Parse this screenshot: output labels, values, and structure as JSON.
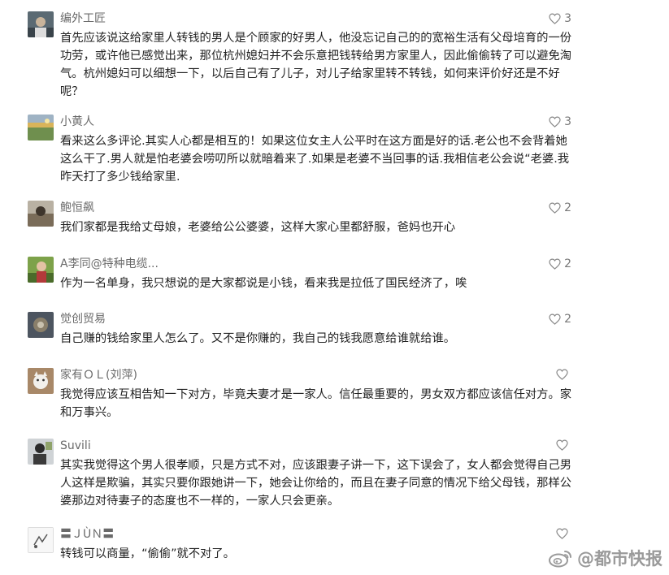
{
  "comments": [
    {
      "username": "编外工匠",
      "likes": "3",
      "text": "首先应该说这给家里人转钱的男人是个顾家的好男人，他没忘记自己的的宽裕生活有父母培育的一份功劳，或许他已感觉出来，那位杭州媳妇并不会乐意把钱转给男方家里人，因此偷偷转了可以避免淘气。杭州媳妇可以细想一下，以后自己有了儿子，对儿子给家里转不转钱，如何来评价好还是不好呢？"
    },
    {
      "username": "小黄人",
      "likes": "3",
      "text": "看来这么多评论.其实人心都是相互的！如果这位女主人公平时在这方面是好的话.老公也不会背着她这么干了.男人就是怕老婆会唠叨所以就暗着来了.如果是老婆不当回事的话.我相信老公会说“老婆.我昨天打了多少钱给家里."
    },
    {
      "username": "鲍恒飙",
      "likes": "2",
      "text": "我们家都是我给丈母娘，老婆给公公婆婆，这样大家心里都舒服，爸妈也开心"
    },
    {
      "username": "A李同@特种电缆...",
      "likes": "2",
      "text": "作为一名单身，我只想说的是大家都说是小钱，看来我是拉低了国民经济了，唉"
    },
    {
      "username": "觉创贸易",
      "likes": "2",
      "text": "自己赚的钱给家里人怎么了。又不是你赚的，我自己的钱我愿意给谁就给谁。"
    },
    {
      "username": "家有ＯＬ(刘萍)",
      "likes": "",
      "text": "我觉得应该互相告知一下对方，毕竟夫妻才是一家人。信任最重要的，男女双方都应该信任对方。家和万事兴。"
    },
    {
      "username": "Suvili",
      "likes": "",
      "text": "其实我觉得这个男人很孝顺，只是方式不对，应该跟妻子讲一下，这下误会了，女人都会觉得自己男人这样是欺骗，其实只要你跟她讲一下，她会让你给的，而且在妻子同意的情况下给父母钱，那样公婆那边对待妻子的态度也不一样的，一家人只会更亲。"
    },
    {
      "username": "〓ＪÙＮ〓",
      "likes": "",
      "text": "转钱可以商量，“偷偷”就不对了。"
    }
  ],
  "watermark": {
    "text": "@都市快报",
    "icon": "weibo-logo-icon"
  },
  "colors": {
    "username": "#6a6a6a",
    "text": "#222222",
    "like": "#777777",
    "watermark": "#9a9a9a"
  }
}
